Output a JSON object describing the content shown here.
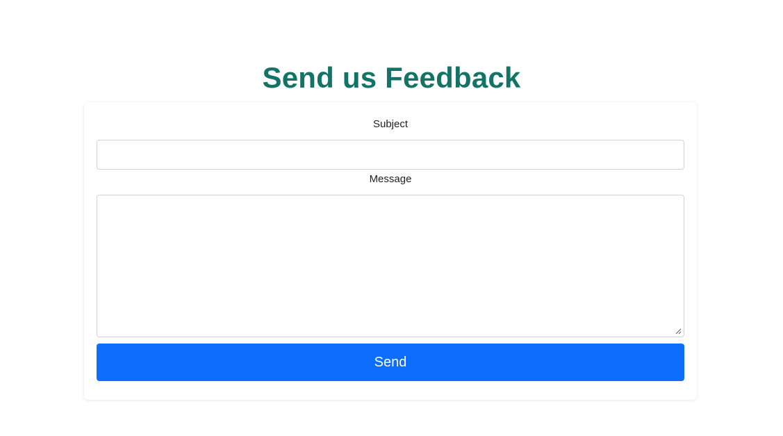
{
  "page": {
    "title": "Send us Feedback"
  },
  "form": {
    "subject_label": "Subject",
    "subject_value": "",
    "subject_placeholder": "",
    "message_label": "Message",
    "message_value": "",
    "message_placeholder": "",
    "send_label": "Send"
  },
  "colors": {
    "title": "#137366",
    "button": "#0d6efd",
    "button_text": "#ffffff",
    "input_border": "#cfd3d7"
  },
  "icons": {
    "resize": "resize-grip-icon"
  }
}
